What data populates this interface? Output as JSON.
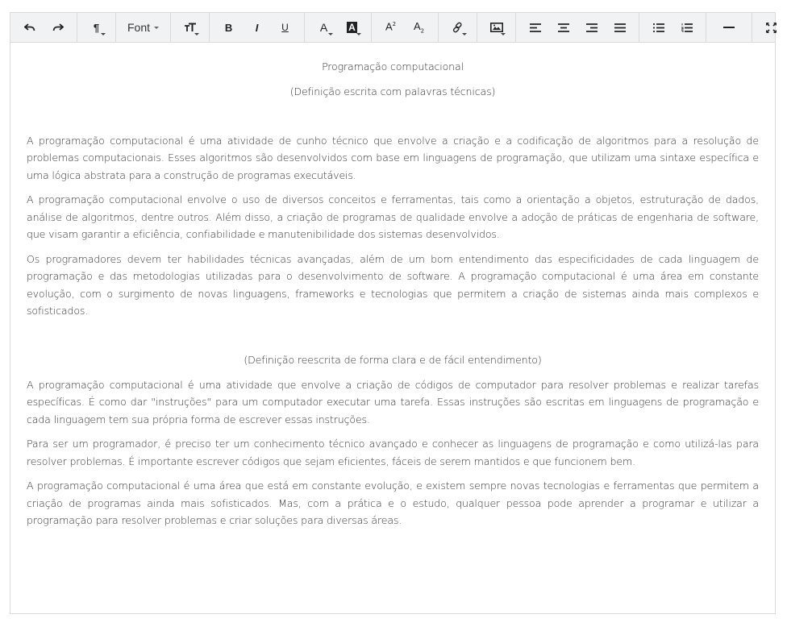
{
  "toolbar": {
    "groups": [
      [
        {
          "name": "undo-button",
          "icon": "undo-icon"
        },
        {
          "name": "redo-button",
          "icon": "redo-icon"
        }
      ],
      [
        {
          "name": "paragraph-style-button",
          "icon": "paragraph-icon"
        },
        {
          "name": "font-button",
          "label": "Font"
        },
        {
          "name": "font-size-button",
          "icon": "text-size-icon"
        }
      ],
      [
        {
          "name": "bold-button",
          "label": "B"
        },
        {
          "name": "italic-button",
          "label": "I"
        },
        {
          "name": "underline-button",
          "label": "U"
        }
      ],
      [
        {
          "name": "font-color-button",
          "label": "A"
        },
        {
          "name": "highlight-color-button",
          "label": "A"
        }
      ],
      [
        {
          "name": "superscript-button",
          "label": "A"
        },
        {
          "name": "subscript-button",
          "label": "A"
        }
      ],
      [
        {
          "name": "link-button",
          "icon": "link-icon"
        }
      ],
      [
        {
          "name": "image-button",
          "icon": "image-icon"
        }
      ],
      [
        {
          "name": "align-left-button",
          "icon": "align-left-icon"
        },
        {
          "name": "align-center-button",
          "icon": "align-center-icon"
        },
        {
          "name": "align-right-button",
          "icon": "align-right-icon"
        },
        {
          "name": "align-justify-button",
          "icon": "align-justify-icon"
        }
      ],
      [
        {
          "name": "bullet-list-button",
          "icon": "bullet-list-icon"
        },
        {
          "name": "numbered-list-button",
          "icon": "numbered-list-icon"
        }
      ],
      [
        {
          "name": "horizontal-rule-button",
          "icon": "horizontal-rule-icon"
        }
      ],
      [
        {
          "name": "fullscreen-button",
          "icon": "fullscreen-icon"
        }
      ]
    ],
    "font_label": "Font",
    "bold_label": "B",
    "italic_label": "I",
    "underline_label": "U",
    "font_color_label": "A",
    "highlight_label": "A",
    "superscript_label": "A",
    "superscript_mark": "2",
    "subscript_label": "A",
    "subscript_mark": "2"
  },
  "document": {
    "title": "Programação computacional",
    "subtitle_technical": "(Definição escrita com palavras técnicas)",
    "technical_paragraphs": [
      "A programação computacional é uma atividade de cunho técnico que envolve a criação e a codificação de algoritmos para a resolução de problemas computacionais. Esses algoritmos são desenvolvidos com base em linguagens de programação, que utilizam uma sintaxe específica e uma lógica abstrata para a construção de programas executáveis.",
      "A programação computacional envolve o uso de diversos conceitos e ferramentas, tais como a orientação a objetos, estruturação de dados, análise de algoritmos, dentre outros. Além disso, a criação de programas de qualidade envolve a adoção de práticas de engenharia de software, que visam garantir a eficiência, confiabilidade e manutenibilidade dos sistemas desenvolvidos.",
      "Os programadores devem ter habilidades técnicas avançadas, além de um bom entendimento das especificidades de cada linguagem de programação e das metodologias utilizadas para o desenvolvimento de software. A programação computacional é uma área em constante evolução, com o surgimento de novas linguagens, frameworks e tecnologias que permitem a criação de sistemas ainda mais complexos e sofisticados."
    ],
    "subtitle_simple": "(Definição reescrita de forma clara e de fácil entendimento)",
    "simple_paragraphs": [
      "A programação computacional é uma atividade que envolve a criação de códigos de computador para resolver problemas e realizar tarefas específicas. É como dar \"instruções\" para um computador executar uma tarefa. Essas instruções são escritas em linguagens de programação e cada linguagem tem sua própria forma de escrever essas instruções.",
      "Para ser um programador, é preciso ter um conhecimento técnico avançado e conhecer as linguagens de programação e como utilizá-las para resolver problemas. É importante escrever códigos que sejam eficientes, fáceis de serem mantidos e que funcionem bem.",
      "A programação computacional é uma área que está em constante evolução, e existem sempre novas tecnologias e ferramentas que permitem a criação de programas ainda mais sofisticados. Mas, com a prática e o estudo, qualquer pessoa pode aprender a programar e utilizar a programação para resolver problemas e criar soluções para diversas áreas."
    ]
  }
}
